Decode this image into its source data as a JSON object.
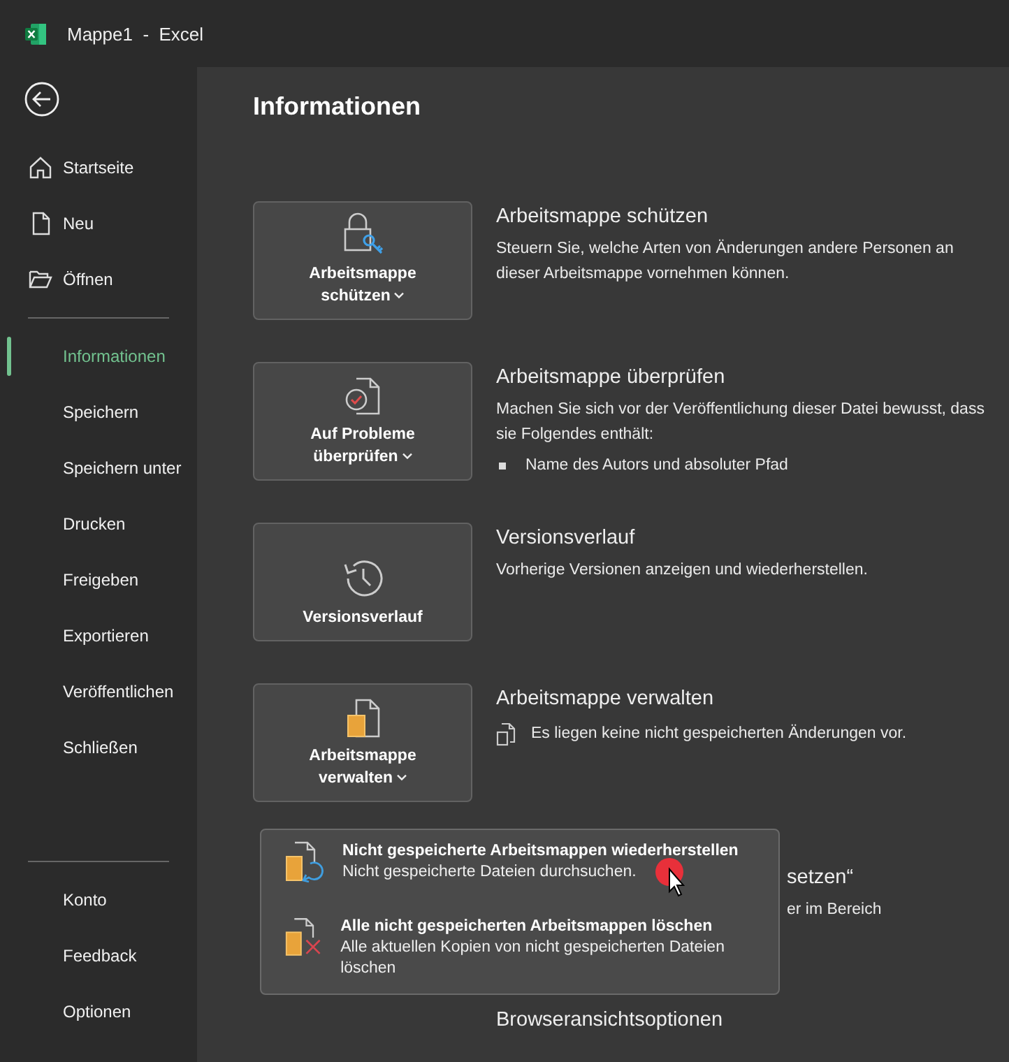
{
  "window": {
    "title": "Mappe1  -  Excel"
  },
  "sidebar": {
    "top_items": [
      {
        "label": "Startseite",
        "selected": false
      },
      {
        "label": "Neu",
        "selected": false
      },
      {
        "label": "Öffnen",
        "selected": false
      }
    ],
    "middle_items": [
      {
        "label": "Informationen",
        "selected": true
      },
      {
        "label": "Speichern",
        "selected": false
      },
      {
        "label": "Speichern unter",
        "selected": false
      },
      {
        "label": "Drucken",
        "selected": false
      },
      {
        "label": "Freigeben",
        "selected": false
      },
      {
        "label": "Exportieren",
        "selected": false
      },
      {
        "label": "Veröffentlichen",
        "selected": false
      },
      {
        "label": "Schließen",
        "selected": false
      }
    ],
    "bottom_items": [
      {
        "label": "Konto",
        "selected": false
      },
      {
        "label": "Feedback",
        "selected": false
      },
      {
        "label": "Optionen",
        "selected": false
      }
    ]
  },
  "page": {
    "title": "Informationen"
  },
  "sections": [
    {
      "kind": "full",
      "button": {
        "label": "Arbeitsmappe schützen",
        "has_menu": true
      },
      "title": "Arbeitsmappe schützen",
      "description": "Steuern Sie, welche Arten von Änderungen andere Personen an dieser Arbeitsmappe vornehmen können."
    },
    {
      "kind": "full",
      "button": {
        "label": "Auf Probleme überprüfen",
        "has_menu": true
      },
      "title": "Arbeitsmappe überprüfen",
      "description": "Machen Sie sich vor der Veröffentlichung dieser Datei bewusst, dass sie Folgendes enthält:",
      "bullets": [
        "Name des Autors und absoluter Pfad"
      ]
    },
    {
      "kind": "full",
      "button": {
        "label": "Versionsverlauf",
        "has_menu": false
      },
      "title": "Versionsverlauf",
      "description": "Vorherige Versionen anzeigen und wiederherstellen."
    },
    {
      "kind": "full",
      "button": {
        "label": "Arbeitsmappe verwalten",
        "has_menu": true
      },
      "title": "Arbeitsmappe verwalten",
      "note": "Es liegen keine nicht gespeicherten Änderungen vor."
    },
    {
      "kind": "partial",
      "title": "setzen“",
      "description": "er im Bereich"
    },
    {
      "kind": "cut",
      "title": "Browseransichtsoptionen"
    }
  ],
  "menu": {
    "items": [
      {
        "title": "Nicht gespeicherte Arbeitsmappen wiederherstellen",
        "description": "Nicht gespeicherte Dateien durchsuchen."
      },
      {
        "title": "Alle nicht gespeicherten Arbeitsmappen löschen",
        "description": "Alle aktuellen Kopien von nicht gespeicherten Dateien löschen"
      }
    ]
  }
}
